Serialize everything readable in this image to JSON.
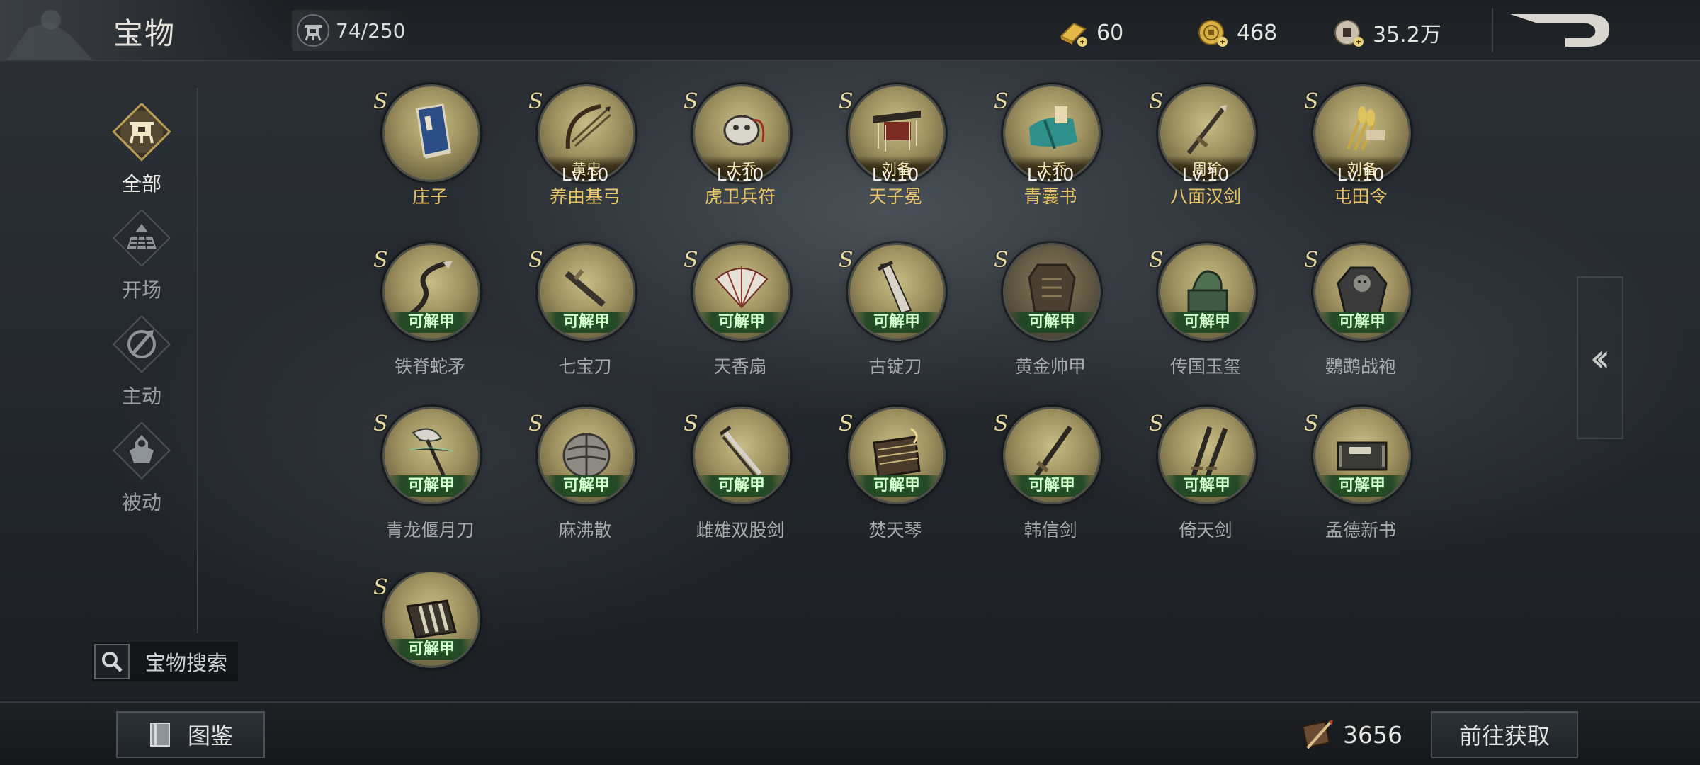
{
  "header": {
    "title": "宝物",
    "capacity": "74/250",
    "currencies": [
      {
        "icon": "gold-bar-icon",
        "value": "60"
      },
      {
        "icon": "gold-coin-icon",
        "value": "468"
      },
      {
        "icon": "copper-coin-icon",
        "value": "35.2万"
      }
    ],
    "back_icon": "return-arrow-icon"
  },
  "nav": {
    "items": [
      {
        "label": "全部",
        "icon": "all-category-icon",
        "active": true
      },
      {
        "label": "开场",
        "icon": "opening-icon",
        "active": false
      },
      {
        "label": "主动",
        "icon": "active-skill-icon",
        "active": false
      },
      {
        "label": "被动",
        "icon": "passive-skill-icon",
        "active": false
      }
    ]
  },
  "search": {
    "label": "宝物搜索",
    "icon": "search-icon"
  },
  "treasures": {
    "row1": [
      {
        "grade": "S",
        "owner": "",
        "level": "",
        "name": "庄子",
        "art": "book"
      },
      {
        "grade": "S",
        "owner": "黄忠",
        "level": "Lv.10",
        "name": "养由基弓",
        "art": "bow"
      },
      {
        "grade": "S",
        "owner": "大乔",
        "level": "Lv.10",
        "name": "虎卫兵符",
        "art": "tiger"
      },
      {
        "grade": "S",
        "owner": "刘备",
        "level": "Lv.10",
        "name": "天子冕",
        "art": "crown"
      },
      {
        "grade": "S",
        "owner": "大乔",
        "level": "Lv.10",
        "name": "青囊书",
        "art": "cloth"
      },
      {
        "grade": "S",
        "owner": "周瑜",
        "level": "Lv.10",
        "name": "八面汉剑",
        "art": "sword"
      },
      {
        "grade": "S",
        "owner": "刘备",
        "level": "Lv.10",
        "name": "屯田令",
        "art": "wheat"
      }
    ],
    "row2": [
      {
        "grade": "S",
        "badge": "可解甲",
        "name": "铁脊蛇矛",
        "art": "spear"
      },
      {
        "grade": "S",
        "badge": "可解甲",
        "name": "七宝刀",
        "art": "dagger"
      },
      {
        "grade": "S",
        "badge": "可解甲",
        "name": "天香扇",
        "art": "fan"
      },
      {
        "grade": "S",
        "badge": "可解甲",
        "name": "古锭刀",
        "art": "blade"
      },
      {
        "grade": "S",
        "badge": "可解甲",
        "name": "黄金帅甲",
        "art": "armor"
      },
      {
        "grade": "S",
        "badge": "可解甲",
        "name": "传国玉玺",
        "art": "seal"
      },
      {
        "grade": "S",
        "badge": "可解甲",
        "name": "鸚鹉战袍",
        "art": "robe"
      }
    ],
    "row3": [
      {
        "grade": "S",
        "badge": "可解甲",
        "name": "青龙偃月刀",
        "art": "glaive"
      },
      {
        "grade": "S",
        "badge": "可解甲",
        "name": "麻沸散",
        "art": "pouch"
      },
      {
        "grade": "S",
        "badge": "可解甲",
        "name": "雌雄双股剑",
        "art": "twinswords"
      },
      {
        "grade": "S",
        "badge": "可解甲",
        "name": "焚天琴",
        "art": "harp"
      },
      {
        "grade": "S",
        "badge": "可解甲",
        "name": "韩信剑",
        "art": "longsword"
      },
      {
        "grade": "S",
        "badge": "可解甲",
        "name": "倚天剑",
        "art": "pairsword"
      },
      {
        "grade": "S",
        "badge": "可解甲",
        "name": "孟德新书",
        "art": "scrolls"
      }
    ],
    "row4": [
      {
        "grade": "S",
        "badge": "可解甲",
        "name": "",
        "art": "slips"
      }
    ]
  },
  "bottom": {
    "catalog_label": "图鉴",
    "points_value": "3656",
    "points_icon": "brush-token-icon",
    "goto_label": "前往获取"
  },
  "side_tab_icon": "double-chevron-left-icon"
}
